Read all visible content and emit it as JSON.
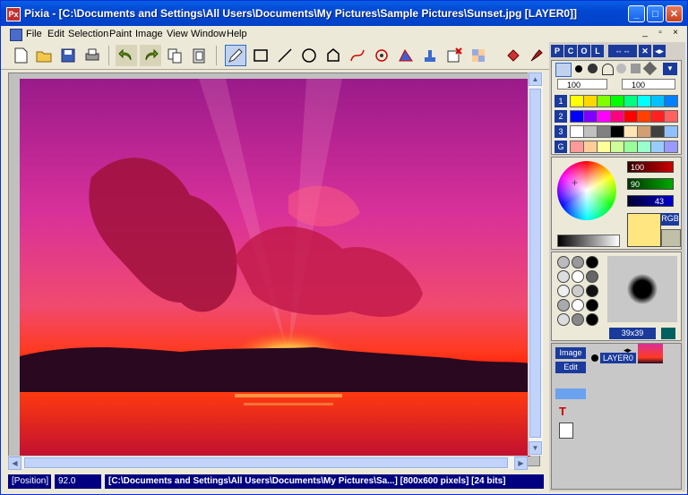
{
  "window": {
    "title": "Pixia - [C:\\Documents and Settings\\All Users\\Documents\\My Pictures\\Sample Pictures\\Sunset.jpg [LAYER0]]",
    "app_icon_text": "Px",
    "minimize": "_",
    "maximize": "□",
    "close": "✕"
  },
  "menu": {
    "items": [
      "File",
      "Edit",
      "Selection",
      "Paint",
      "Image",
      "View",
      "Window",
      "Help"
    ],
    "mdi_controls": [
      "_",
      "▫",
      "×"
    ]
  },
  "status": {
    "position_label": "[Position]",
    "zoom_value": "92.0",
    "file_info": "[C:\\Documents and Settings\\All Users\\Documents\\My Pictures\\Sa...] [800x600 pixels] [24 bits]"
  },
  "panel": {
    "tabs": [
      "P",
      "C",
      "O",
      "L"
    ],
    "tool_values": [
      "100",
      "100"
    ],
    "palette_rows": [
      "1",
      "2",
      "3",
      "G"
    ],
    "colors": {
      "row1": [
        "#ffff00",
        "#ffd700",
        "#80ff00",
        "#00ff00",
        "#00ff80",
        "#00ffff",
        "#00c0ff",
        "#0080ff"
      ],
      "row2": [
        "#0000ff",
        "#8000ff",
        "#ff00ff",
        "#ff0080",
        "#ff0000",
        "#ff4000",
        "#ff2020",
        "#ff6060"
      ],
      "row3": [
        "#ffffff",
        "#c0c0c0",
        "#808080",
        "#000000",
        "#ffe4b5",
        "#d2a070",
        "#404040",
        "#90c0ff"
      ],
      "rowG": [
        "#ff9999",
        "#ffcc99",
        "#ffff99",
        "#ccff99",
        "#99ff99",
        "#99ffcc",
        "#99ccff",
        "#9999ff"
      ]
    },
    "rgb_values": [
      "100",
      "90",
      "43"
    ],
    "rgb_colors": [
      "#cc0000",
      "#00aa00",
      "#0000cc"
    ],
    "rgb_button": "RGB",
    "current_color": "#ffe680",
    "brush_size": "39x39",
    "layer": {
      "image_button": "Image",
      "edit_button": "Edit",
      "layer_name": "LAYER0"
    }
  }
}
